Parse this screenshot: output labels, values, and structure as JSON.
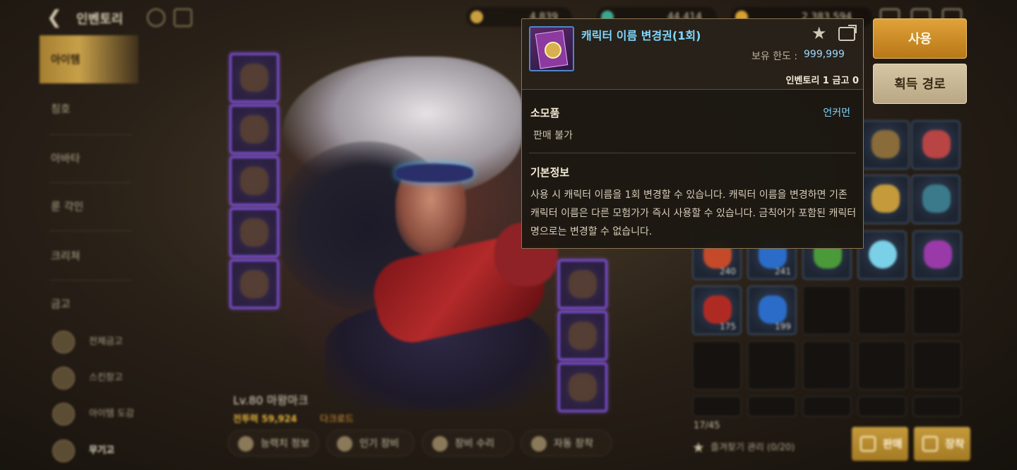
{
  "topbar": {
    "title": "인벤토리",
    "currencies": [
      {
        "value": "4,839",
        "color": "#c9a040"
      },
      {
        "value": "44,414",
        "color": "#3aa890"
      },
      {
        "value": "2,383,594",
        "color": "#d8a030"
      }
    ]
  },
  "sidebar": {
    "items": [
      {
        "label": "아이템",
        "active": true
      },
      {
        "label": "칭호",
        "active": false
      },
      {
        "label": "아바타",
        "active": false
      },
      {
        "label": "룬 각인",
        "active": false
      },
      {
        "label": "크리쳐",
        "active": false
      },
      {
        "label": "금고",
        "active": false
      }
    ],
    "subs": [
      {
        "label": "전체금고"
      },
      {
        "label": "스킨창고"
      },
      {
        "label": "아이템 도감"
      },
      {
        "label": "무기고"
      }
    ]
  },
  "character": {
    "level_name": "Lv.80 마왕마크",
    "combat_power": "전투력 59,924",
    "class_label": "다크로드"
  },
  "bottom_buttons": [
    {
      "label": "능력치 정보"
    },
    {
      "label": "인기 장비"
    },
    {
      "label": "장비 수리"
    },
    {
      "label": "자동 장착"
    }
  ],
  "inventory": {
    "count": "17/45",
    "favorites": "즐겨찾기 관리 (0/20)",
    "sell_label": "판매",
    "equip_label": "장착",
    "quantities": [
      "240",
      "241",
      "175",
      "199"
    ],
    "colors": {
      "red_potion": "#b02a24",
      "blue_potion": "#2a6cc8",
      "green_item": "#4a9a3a",
      "orb": "#7ad0e6",
      "card": "#9a3aa8",
      "box": "#8a6c3a",
      "question": "#c49a3a"
    }
  },
  "actions": {
    "use": "사용",
    "route": "획득 경로"
  },
  "tooltip": {
    "item_name": "캐릭터 이름 변경권(1회)",
    "limit_label": "보유 한도 :",
    "limit_value": "999,999",
    "storage": "인벤토리 1 금고 0",
    "type": "소모품",
    "grade": "언커먼",
    "sell": "판매 불가",
    "info_title": "기본정보",
    "description": "사용 시 캐릭터 이름을 1회 변경할 수 있습니다. 캐릭터 이름을 변경하면 기존 캐릭터 이름은 다른 모험가가 즉시 사용할 수 있습니다. 금칙어가 포함된 캐릭터명으로는 변경할 수 없습니다.",
    "accent": "#7fd6ff"
  }
}
